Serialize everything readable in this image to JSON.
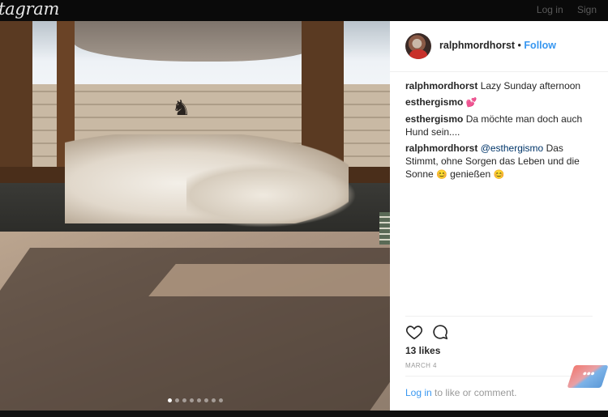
{
  "topbar": {
    "brand": "tagram",
    "login": "Log in",
    "signup": "Sign"
  },
  "post": {
    "author": "ralphmordhorst",
    "separator": "•",
    "follow_label": "Follow",
    "comments": [
      {
        "user": "ralphmordhorst",
        "text": "Lazy Sunday afternoon",
        "emoji": ""
      },
      {
        "user": "esthergismo",
        "text": "",
        "emoji": "💕"
      },
      {
        "user": "esthergismo",
        "text": "Da möchte man doch auch Hund sein....",
        "emoji": ""
      },
      {
        "user": "ralphmordhorst",
        "mention": "@esthergismo",
        "text": "Das Stimmt, ohne Sorgen das Leben und die Sonne",
        "emoji": "😊",
        "text2": "genießen",
        "emoji2": "😊"
      }
    ],
    "likes": "13 likes",
    "date": "MARCH 4",
    "login_link": "Log in",
    "login_suffix": "to like or comment.",
    "carousel": {
      "count": 8,
      "active_index": 0
    }
  },
  "more_button": {
    "label": "•••"
  },
  "colors": {
    "accent": "#3897f0",
    "text": "#262626",
    "muted": "#999999"
  }
}
